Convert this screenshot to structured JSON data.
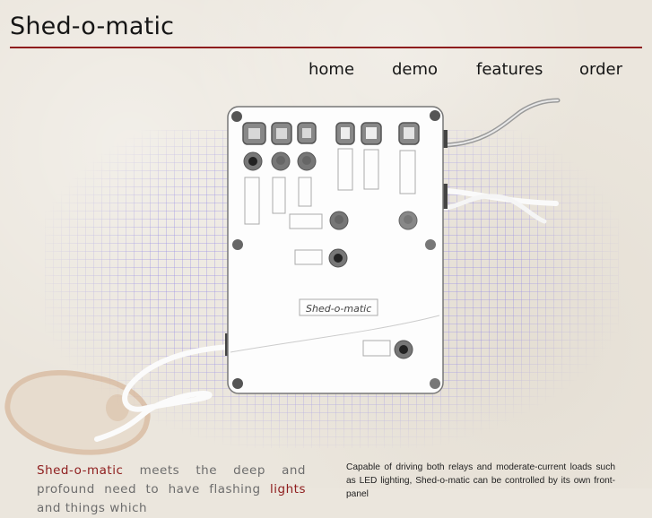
{
  "header": {
    "site_title": "Shed-o-matic",
    "accent_color": "#8e1d1d"
  },
  "nav": {
    "items": [
      {
        "label": "home"
      },
      {
        "label": "demo"
      },
      {
        "label": "features"
      },
      {
        "label": "order"
      }
    ]
  },
  "illustration": {
    "panel_label": "Shed-o-matic",
    "description": "Sketch of the Shed-o-matic control box with buttons, LEDs and wires on graph paper"
  },
  "content": {
    "left_intro": {
      "brand": "Shed-o-matic",
      "text_1": " meets the deep and profound need to have flashing ",
      "highlight": "lights",
      "text_2": " and things which"
    },
    "right_text": "Capable of driving both relays and moderate-current loads such as LED lighting, Shed-o-matic can be controlled by its own front-panel"
  }
}
